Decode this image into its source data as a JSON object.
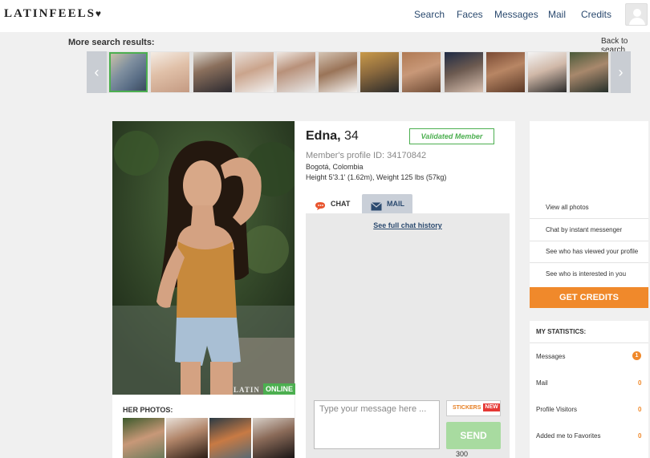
{
  "header": {
    "logo": "LATINFEELS",
    "logo_mark": "♥",
    "nav": [
      "Search",
      "Faces",
      "Messages",
      "Mail",
      "Credits"
    ]
  },
  "results": {
    "label": "More search results:",
    "back": "Back to search",
    "prev_arrow": "‹",
    "next_arrow": "›",
    "thumb_count": 12
  },
  "profile": {
    "name": "Edna,",
    "age": "34",
    "validated": "Validated Member",
    "profile_id": "Member's profile ID: 34170842",
    "location": "Bogotá, Colombia",
    "height_weight": "Height 5'3.1' (1.62m), Weight 125 lbs (57kg)",
    "online": "ONLINE",
    "watermark": "LATIN",
    "her_photos": "HER PHOTOS:"
  },
  "tabs": {
    "chat": "CHAT",
    "mail": "MAIL"
  },
  "chat": {
    "history": "See full chat history",
    "placeholder": "Type your message here ...",
    "stickers": "STICKERS",
    "new_badge": "NEW",
    "send": "SEND",
    "counter": "300"
  },
  "sidebar": {
    "links": [
      "View all photos",
      "Chat by instant messenger",
      "See who has viewed your profile",
      "See who is interested in you"
    ],
    "credits_button": "GET CREDITS"
  },
  "stats": {
    "title": "MY STATISTICS:",
    "items": [
      {
        "label": "Messages",
        "value": "1"
      },
      {
        "label": "Mail",
        "value": "0"
      },
      {
        "label": "Profile Visitors",
        "value": "0"
      },
      {
        "label": "Added me to Favorites",
        "value": "0"
      }
    ]
  },
  "colors": {
    "accent_orange": "#f0892b",
    "online_green": "#4caf50",
    "nav_blue": "#2b4a6f"
  }
}
